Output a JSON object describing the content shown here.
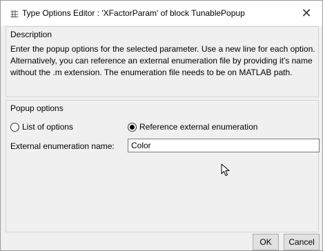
{
  "window": {
    "title": "Type Options Editor : 'XFactorParam' of block TunablePopup",
    "close_glyph": "✕"
  },
  "description": {
    "header": "Description",
    "text": "Enter the popup options for the selected parameter. Use a new line for each option. Alternatively, you can reference an external enumeration file by providing it's name without the .m extension. The enumeration file needs to be on MATLAB path."
  },
  "popup_options": {
    "header": "Popup options",
    "radio_list": {
      "label": "List of options",
      "checked": false
    },
    "radio_external": {
      "label": "Reference external enumeration",
      "checked": true
    },
    "field_label": "External enumeration name:",
    "field_value": "Color"
  },
  "buttons": {
    "ok": "OK",
    "cancel": "Cancel"
  },
  "icons": {
    "app": "matlab-grid-icon",
    "close": "close-icon",
    "cursor": "mouse-pointer-icon"
  },
  "colors": {
    "dialog_bg": "#f0f0f0",
    "titlebar_bg": "#ffffff",
    "border": "#d3d3d3"
  }
}
